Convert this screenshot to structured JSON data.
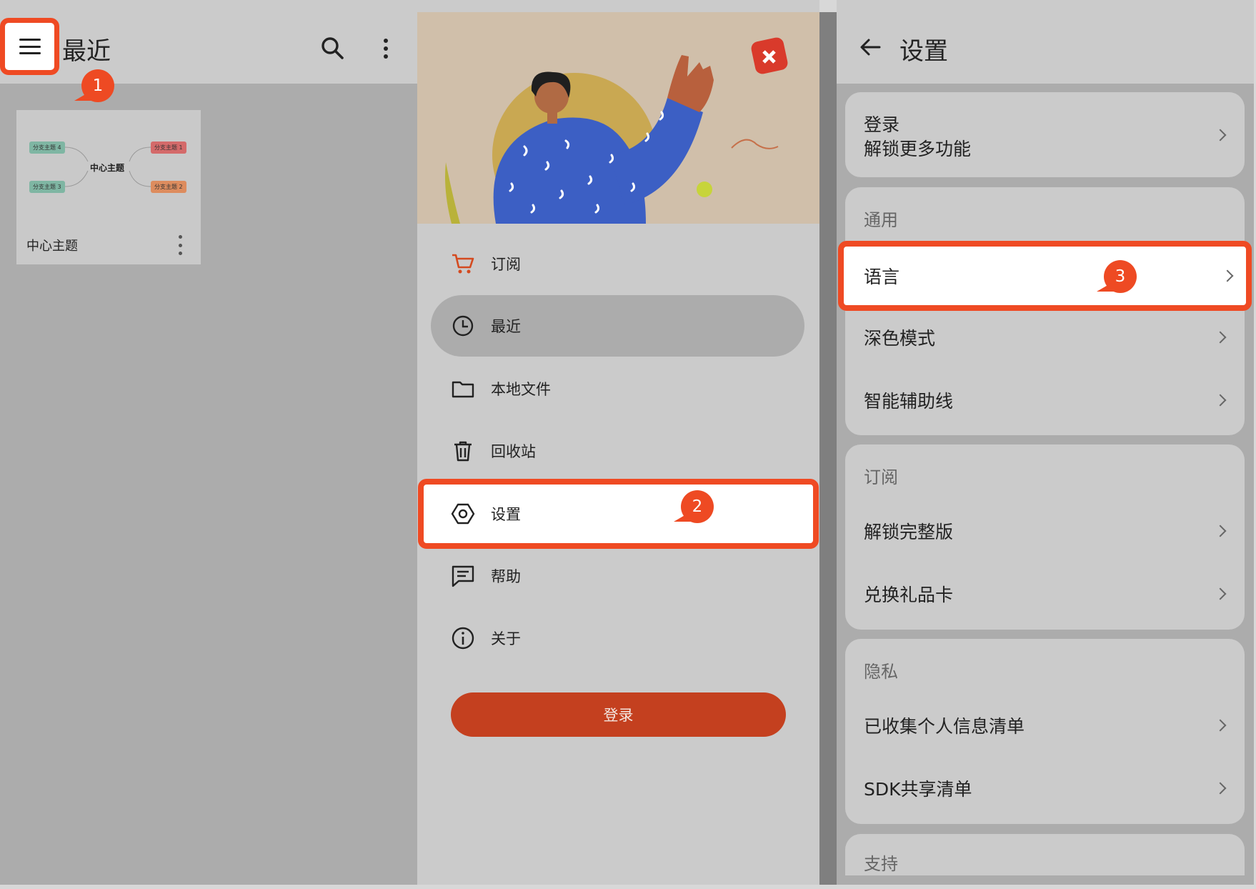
{
  "recent": {
    "title": "最近",
    "card": {
      "name": "中心主题",
      "center": "中心主题",
      "nodes": [
        "分支主题 4",
        "分支主题 1",
        "分支主题 3",
        "分支主题 2"
      ]
    }
  },
  "steps": [
    "1",
    "2",
    "3"
  ],
  "drawer": {
    "items": [
      "订阅",
      "最近",
      "本地文件",
      "回收站",
      "设置",
      "帮助",
      "关于"
    ],
    "login": "登录"
  },
  "settings": {
    "title": "设置",
    "login_title": "登录",
    "login_sub": "解锁更多功能",
    "general": {
      "header": "通用",
      "rows": [
        "语言",
        "深色模式",
        "智能辅助线"
      ]
    },
    "subscription": {
      "header": "订阅",
      "rows": [
        "解锁完整版",
        "兑换礼品卡"
      ]
    },
    "privacy": {
      "header": "隐私",
      "rows": [
        "已收集个人信息清单",
        "SDK共享清单"
      ]
    },
    "support": {
      "header": "支持"
    }
  },
  "colors": {
    "accent": "#ef4a23",
    "login_button": "#c4401f",
    "panel": "#cbcbcb",
    "background": "#acacac"
  }
}
